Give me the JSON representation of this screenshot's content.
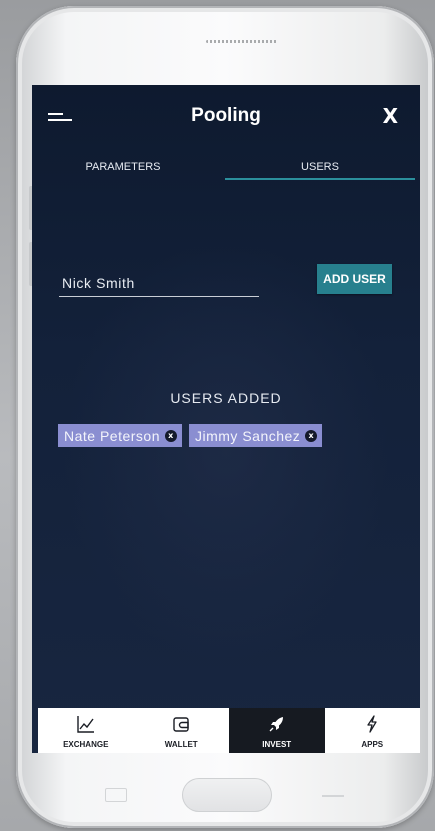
{
  "header": {
    "title": "Pooling",
    "close_label": "X"
  },
  "tabs": [
    {
      "label": "PARAMETERS",
      "active": false
    },
    {
      "label": "USERS",
      "active": true
    }
  ],
  "add_user": {
    "input_value": "Nick Smith",
    "button_label": "ADD USER"
  },
  "users_added": {
    "heading": "USERS ADDED",
    "chips": [
      {
        "name": "Nate Peterson",
        "remove_label": "x"
      },
      {
        "name": "Jimmy Sanchez",
        "remove_label": "x"
      }
    ]
  },
  "bottom_nav": [
    {
      "label": "EXCHANGE",
      "icon": "chart-icon",
      "active": false
    },
    {
      "label": "WALLET",
      "icon": "wallet-icon",
      "active": false
    },
    {
      "label": "INVEST",
      "icon": "rocket-icon",
      "active": true
    },
    {
      "label": "APPS",
      "icon": "lightning-icon",
      "active": false
    }
  ],
  "colors": {
    "screen_background": "#13213a",
    "accent_teal": "#27808e",
    "chip_background": "#8a8ed1",
    "nav_active_background": "#161a21"
  }
}
